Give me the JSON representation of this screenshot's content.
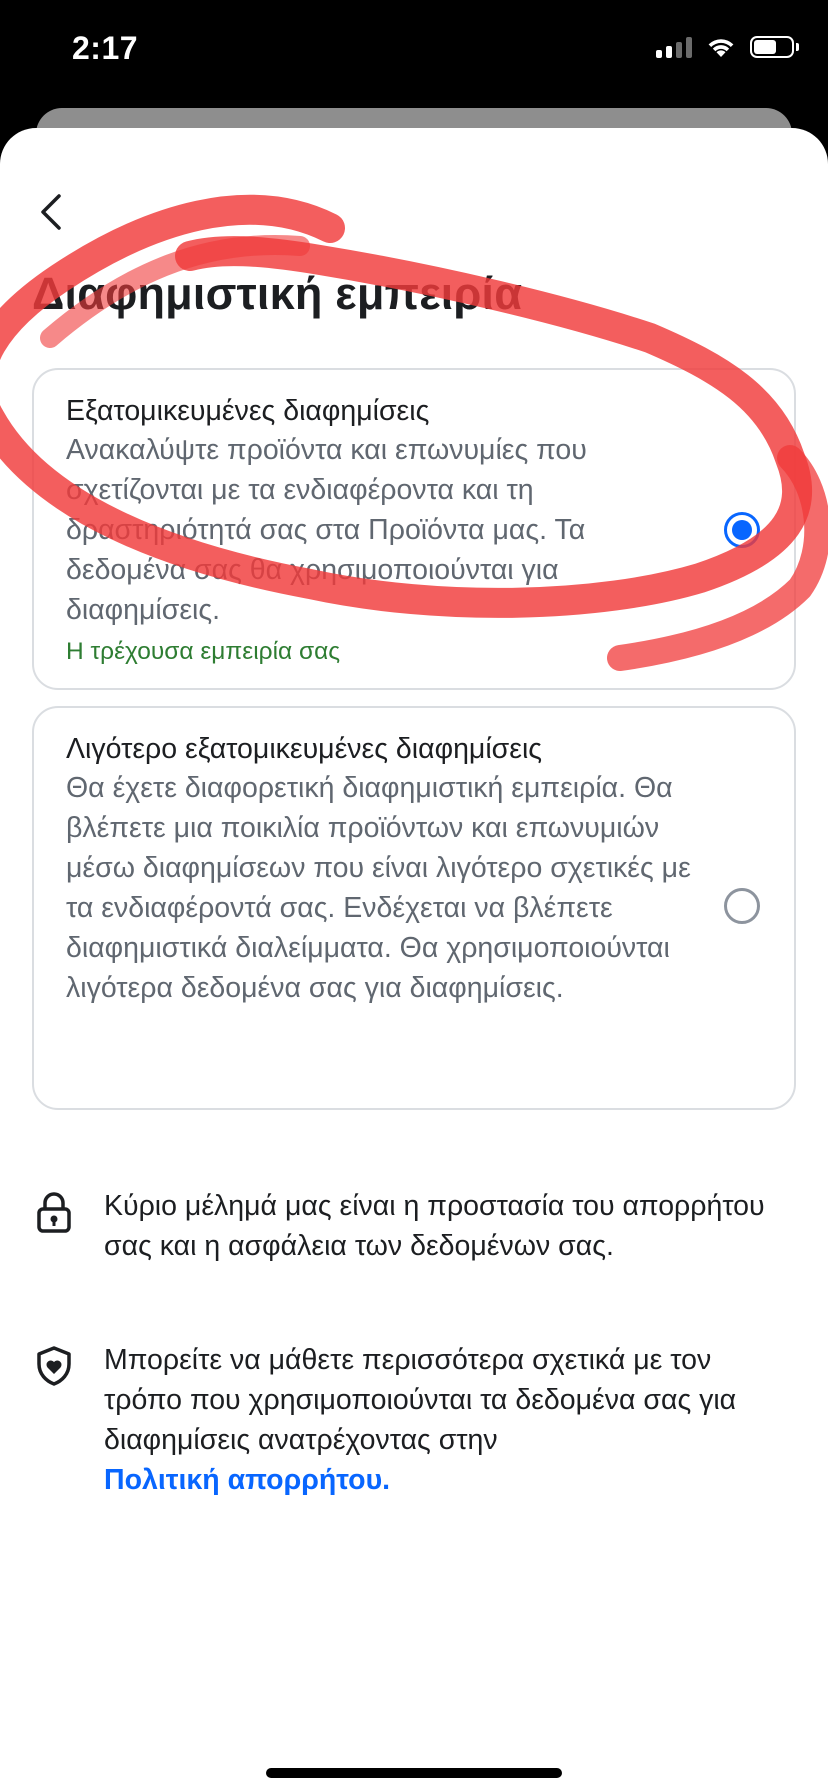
{
  "status_bar": {
    "time": "2:17"
  },
  "page": {
    "title": "Διαφημιστική εμπειρία"
  },
  "options": [
    {
      "title": "Εξατομικευμένες διαφημίσεις",
      "description": "Ανακαλύψτε προϊόντα και επωνυμίες που σχετίζονται με τα ενδιαφέροντα και τη δραστηριότητά σας στα Προϊόντα μας. Τα δεδομένα σας θα χρησιμοποιούνται για διαφημίσεις.",
      "current_label": "Η τρέχουσα εμπειρία σας",
      "selected": true
    },
    {
      "title": "Λιγότερο εξατομικευμένες διαφημίσεις",
      "description": "Θα έχετε διαφορετική διαφημιστική εμπειρία. Θα βλέπετε μια ποικιλία προϊόντων και επωνυμιών μέσω διαφημίσεων που είναι λιγότερο σχετικές με τα ενδιαφέροντά σας. Ενδέχεται να βλέπετε διαφημιστικά διαλείμματα. Θα χρησιμοποιούνται λιγότερα δεδομένα σας για διαφημίσεις.",
      "selected": false
    }
  ],
  "info": [
    {
      "icon": "lock-icon",
      "text": "Κύριο μέλημά μας είναι η προστασία του απορρήτου σας και η ασφάλεια των δεδομένων σας."
    },
    {
      "icon": "shield-heart-icon",
      "text": "Μπορείτε να μάθετε περισσότερα σχετικά με τον τρόπο που χρησιμοποιούνται τα δεδομένα σας για διαφημίσεις ανατρέχοντας στην",
      "link_text": "Πολιτική απορρήτου."
    }
  ],
  "colors": {
    "accent": "#0866ff",
    "current_label": "#2e7d32",
    "annotation": "#f03a3a"
  }
}
